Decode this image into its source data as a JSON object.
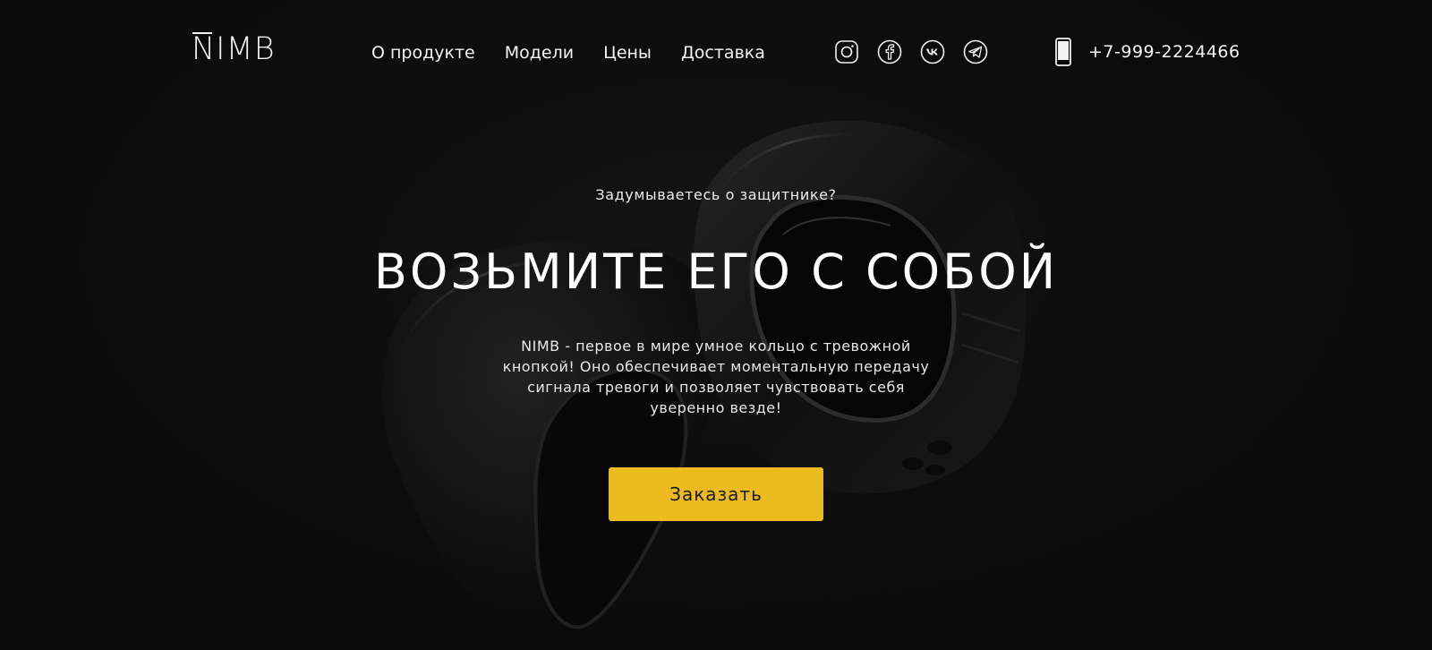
{
  "header": {
    "logo": "NIMB",
    "nav": [
      {
        "label": "О продукте"
      },
      {
        "label": "Модели"
      },
      {
        "label": "Цены"
      },
      {
        "label": "Доставка"
      }
    ],
    "social": [
      {
        "icon": "instagram-icon"
      },
      {
        "icon": "facebook-icon"
      },
      {
        "icon": "vk-icon"
      },
      {
        "icon": "telegram-icon"
      }
    ],
    "phone": {
      "icon": "phone-icon",
      "number": "+7-999-2224466"
    }
  },
  "hero": {
    "subtitle": "Задумываетесь о защитнике?",
    "title": "ВОЗЬМИТЕ ЕГО С СОБОЙ",
    "description": "NIMB - первое в мире умное кольцо с тревожной кнопкой! Оно обеспечивает моментальную передачу сигнала тревоги и позволяет чувствовать себя уверенно везде!",
    "cta_label": "Заказать"
  },
  "colors": {
    "background": "#0b0b0b",
    "accent": "#ebbb1f",
    "text": "#f2f2f2"
  }
}
